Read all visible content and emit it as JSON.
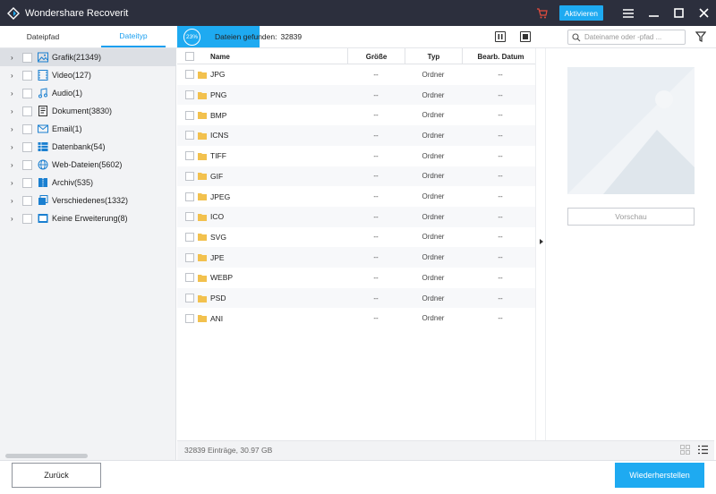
{
  "window": {
    "title": "Wondershare Recoverit",
    "activate_label": "Aktivieren"
  },
  "tabs": [
    {
      "label": "Dateipfad",
      "active": false
    },
    {
      "label": "Dateityp",
      "active": true
    }
  ],
  "scan": {
    "progress_percent": 23,
    "progress_label": "23%",
    "found_label": "Dateien gefunden:",
    "found_count": "32839"
  },
  "search": {
    "placeholder": "Dateiname oder -pfad ..."
  },
  "sidebar": {
    "items": [
      {
        "label": "Grafik(21349)",
        "icon": "image-icon",
        "selected": true
      },
      {
        "label": "Video(127)",
        "icon": "video-icon",
        "selected": false
      },
      {
        "label": "Audio(1)",
        "icon": "music-note-icon",
        "selected": false
      },
      {
        "label": "Dokument(3830)",
        "icon": "document-icon",
        "selected": false
      },
      {
        "label": "Email(1)",
        "icon": "envelope-icon",
        "selected": false
      },
      {
        "label": "Datenbank(54)",
        "icon": "database-icon",
        "selected": false
      },
      {
        "label": "Web-Dateien(5602)",
        "icon": "globe-icon",
        "selected": false
      },
      {
        "label": "Archiv(535)",
        "icon": "archive-icon",
        "selected": false
      },
      {
        "label": "Verschiedenes(1332)",
        "icon": "misc-files-icon",
        "selected": false
      },
      {
        "label": "Keine Erweiterung(8)",
        "icon": "no-extension-icon",
        "selected": false
      }
    ]
  },
  "table": {
    "columns": {
      "name": "Name",
      "size": "Größe",
      "type": "Typ",
      "date": "Bearb. Datum"
    },
    "rows": [
      {
        "name": "JPG",
        "size": "--",
        "type": "Ordner",
        "date": "--"
      },
      {
        "name": "PNG",
        "size": "--",
        "type": "Ordner",
        "date": "--"
      },
      {
        "name": "BMP",
        "size": "--",
        "type": "Ordner",
        "date": "--"
      },
      {
        "name": "ICNS",
        "size": "--",
        "type": "Ordner",
        "date": "--"
      },
      {
        "name": "TIFF",
        "size": "--",
        "type": "Ordner",
        "date": "--"
      },
      {
        "name": "GIF",
        "size": "--",
        "type": "Ordner",
        "date": "--"
      },
      {
        "name": "JPEG",
        "size": "--",
        "type": "Ordner",
        "date": "--"
      },
      {
        "name": "ICO",
        "size": "--",
        "type": "Ordner",
        "date": "--"
      },
      {
        "name": "SVG",
        "size": "--",
        "type": "Ordner",
        "date": "--"
      },
      {
        "name": "JPE",
        "size": "--",
        "type": "Ordner",
        "date": "--"
      },
      {
        "name": "WEBP",
        "size": "--",
        "type": "Ordner",
        "date": "--"
      },
      {
        "name": "PSD",
        "size": "--",
        "type": "Ordner",
        "date": "--"
      },
      {
        "name": "ANI",
        "size": "--",
        "type": "Ordner",
        "date": "--"
      }
    ]
  },
  "status": {
    "summary": "32839 Einträge, 30.97 GB"
  },
  "preview": {
    "button_label": "Vorschau"
  },
  "footer": {
    "back_label": "Zurück",
    "recover_label": "Wiederherstellen"
  },
  "colors": {
    "accent": "#1eaaf1",
    "titlebar": "#2c2f3d",
    "folder": "#f2c14e",
    "cart": "#e84c3d"
  }
}
